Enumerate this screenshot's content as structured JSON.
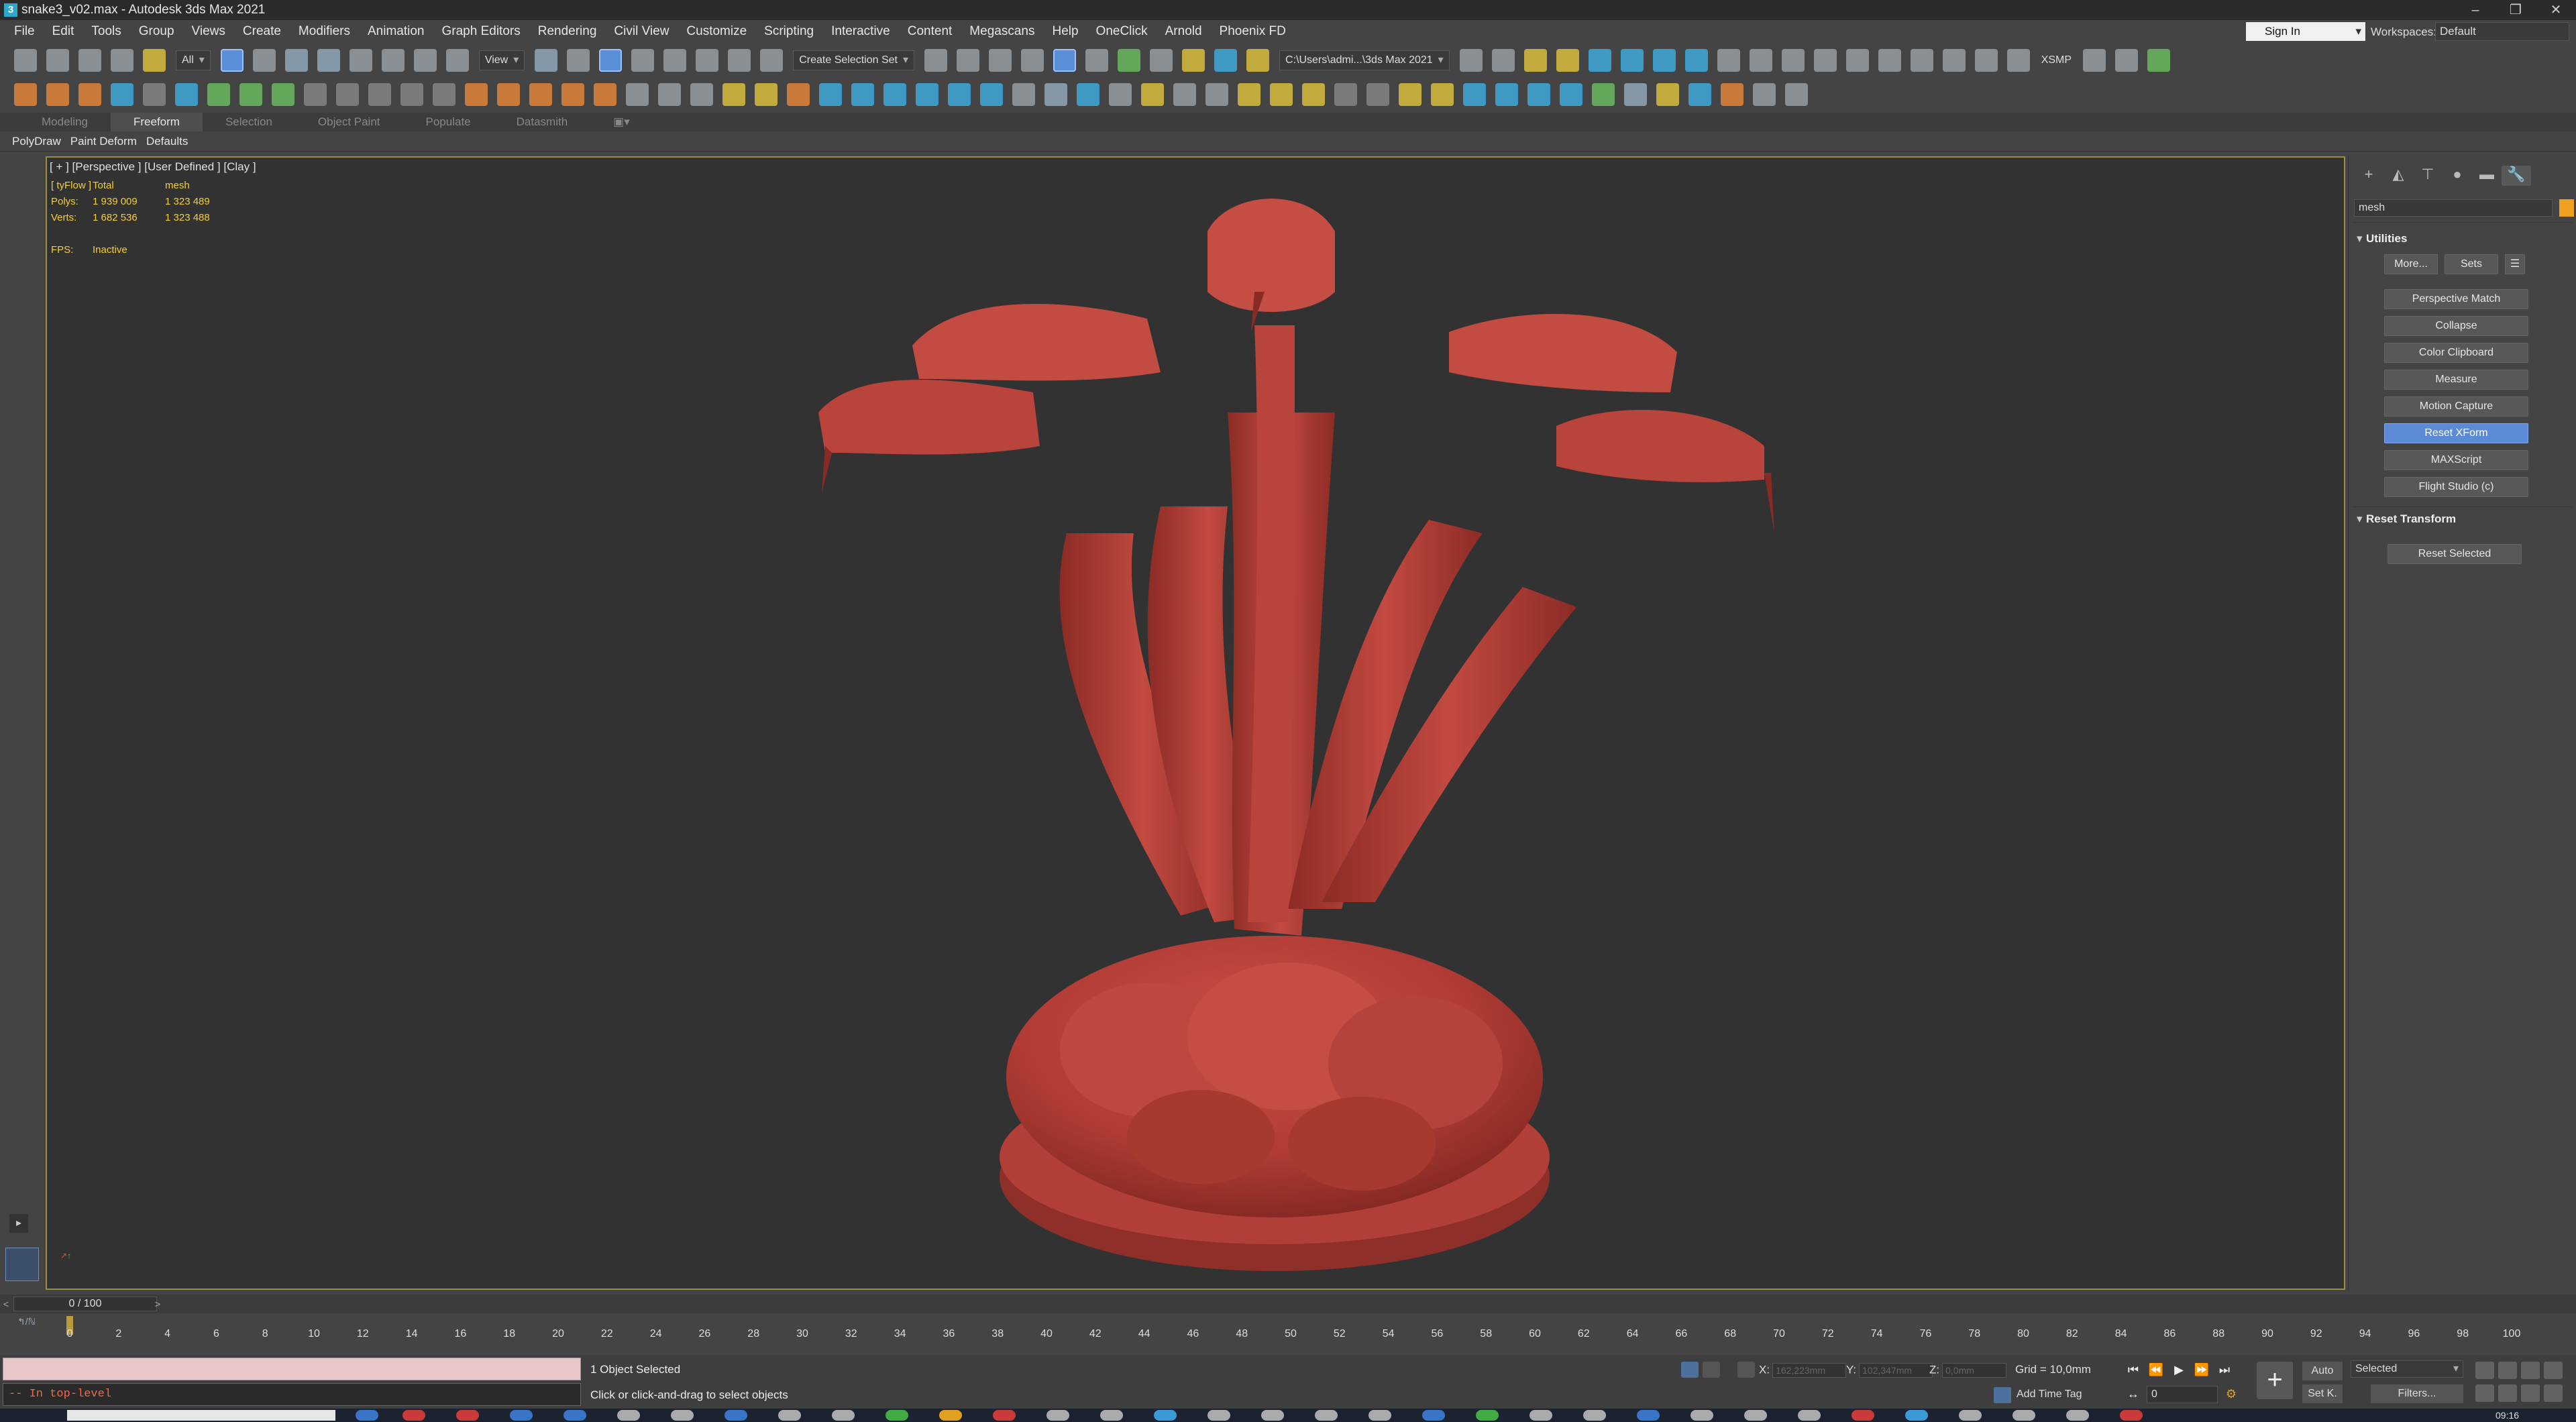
{
  "window": {
    "title": "snake3_v02.max - Autodesk 3ds Max 2021",
    "controls": [
      "–",
      "❐",
      "✕"
    ]
  },
  "menubar": [
    "File",
    "Edit",
    "Tools",
    "Group",
    "Views",
    "Create",
    "Modifiers",
    "Animation",
    "Graph Editors",
    "Rendering",
    "Civil View",
    "Customize",
    "Scripting",
    "Interactive",
    "Content",
    "Megascans",
    "Help",
    "OneClick",
    "Arnold",
    "Phoenix FD"
  ],
  "account": {
    "signin": "Sign In",
    "workspaces_label": "Workspaces:",
    "workspace": "Default"
  },
  "toolbar": {
    "selection_filter": "All",
    "ref_coord": "View",
    "named_selection": "Create Selection Set",
    "project_path": "C:\\Users\\admi...\\3ds Max 2021",
    "xsmp": "XSMP"
  },
  "ribbon": {
    "tabs": [
      "Modeling",
      "Freeform",
      "Selection",
      "Object Paint",
      "Populate",
      "Datasmith"
    ],
    "active_tab": "Freeform",
    "subitems": [
      "PolyDraw",
      "Paint Deform",
      "Defaults"
    ]
  },
  "viewport": {
    "label": "[ + ] [Perspective ] [User Defined ] [Clay ]",
    "stats": {
      "header": [
        "[ tyFlow ]",
        "Total",
        "mesh"
      ],
      "polys": [
        "Polys:",
        "1 939 009",
        "1 323 489"
      ],
      "verts": [
        "Verts:",
        "1 682 536",
        "1 323 488"
      ],
      "fps": [
        "FPS:",
        "Inactive"
      ]
    },
    "model_color": "#b8413a",
    "background": "#323232"
  },
  "command_panel": {
    "search": "mesh",
    "utilities_title": "Utilities",
    "top_buttons": [
      "More...",
      "Sets"
    ],
    "utilities": [
      "Perspective Match",
      "Collapse",
      "Color Clipboard",
      "Measure",
      "Motion Capture",
      "Reset XForm",
      "MAXScript",
      "Flight Studio (c)"
    ],
    "active_utility": "Reset XForm",
    "reset_title": "Reset Transform",
    "reset_button": "Reset Selected"
  },
  "timeslider": {
    "label": "0 / 100",
    "from_label": "↰/ℕ",
    "current": 0,
    "ticks": [
      "0",
      "2",
      "4",
      "6",
      "8",
      "10",
      "12",
      "14",
      "16",
      "18",
      "20",
      "22",
      "24",
      "26",
      "28",
      "30",
      "32",
      "34",
      "36",
      "38",
      "40",
      "42",
      "44",
      "46",
      "48",
      "50",
      "52",
      "54",
      "56",
      "58",
      "60",
      "62",
      "64",
      "66",
      "68",
      "70",
      "72",
      "74",
      "76",
      "78",
      "80",
      "82",
      "84",
      "86",
      "88",
      "90",
      "92",
      "94",
      "96",
      "98",
      "100"
    ]
  },
  "status": {
    "maxscript_listener": "",
    "maxscript_output": "-- In top-level",
    "selection": "1 Object Selected",
    "prompt": "Click or click-and-drag to select objects",
    "x_label": "X:",
    "x_value": "162,223mm",
    "y_label": "Y:",
    "y_value": "102,347mm",
    "z_label": "Z:",
    "z_value": "0,0mm",
    "grid": "Grid = 10,0mm",
    "add_time_tag": "Add Time Tag",
    "auto": "Auto",
    "setk": "Set K.",
    "key_filter": "Selected",
    "filters": "Filters...",
    "frame": "0"
  },
  "taskbar": {
    "clock": "09:16"
  }
}
